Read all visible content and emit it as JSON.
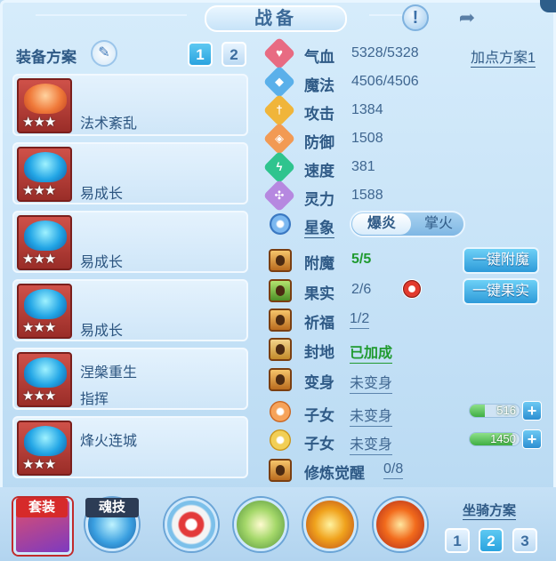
{
  "title": "战备",
  "left": {
    "header": "装备方案",
    "plans": [
      "1",
      "2"
    ],
    "equipment": [
      {
        "line1": "",
        "line2": "法术紊乱",
        "stars": "★★★"
      },
      {
        "line1": "",
        "line2": "易成长",
        "stars": "★★★"
      },
      {
        "line1": "",
        "line2": "易成长",
        "stars": "★★★"
      },
      {
        "line1": "",
        "line2": "易成长",
        "stars": "★★★"
      },
      {
        "line1": "涅槃重生",
        "line2": "指挥",
        "stars": "★★★"
      },
      {
        "line1": "烽火连城",
        "line2": "",
        "stars": "★★★"
      }
    ]
  },
  "stats": {
    "add_points_plan": "加点方案1",
    "hp": {
      "label": "气血",
      "value": "5328/5328"
    },
    "mp": {
      "label": "魔法",
      "value": "4506/4506"
    },
    "attack": {
      "label": "攻击",
      "value": "1384"
    },
    "defense": {
      "label": "防御",
      "value": "1508"
    },
    "speed": {
      "label": "速度",
      "value": "381"
    },
    "spirit": {
      "label": "灵力",
      "value": "1588"
    },
    "constellation": {
      "label": "星象",
      "options": [
        "爆炎",
        "掌火"
      ]
    }
  },
  "extras": {
    "enchant": {
      "label": "附魔",
      "value": "5/5",
      "button": "一键附魔"
    },
    "fruit": {
      "label": "果实",
      "value": "2/6",
      "button": "一键果实"
    },
    "blessing": {
      "label": "祈福",
      "value": "1/2"
    },
    "fief": {
      "label": "封地",
      "value": "已加成"
    },
    "transform": {
      "label": "变身",
      "value": "未变身"
    },
    "child1": {
      "label": "子女",
      "value": "未变身",
      "bar": "516",
      "fill": 0.3
    },
    "child2": {
      "label": "子女",
      "value": "未变身",
      "bar": "1450",
      "fill": 0.85
    },
    "cultivation": {
      "label": "修炼觉醒",
      "value": "0/8"
    }
  },
  "bottom": {
    "set_label": "套装",
    "soul_label": "魂技",
    "mount_plan": "坐骑方案",
    "mount_plans": [
      "1",
      "2",
      "3"
    ]
  }
}
